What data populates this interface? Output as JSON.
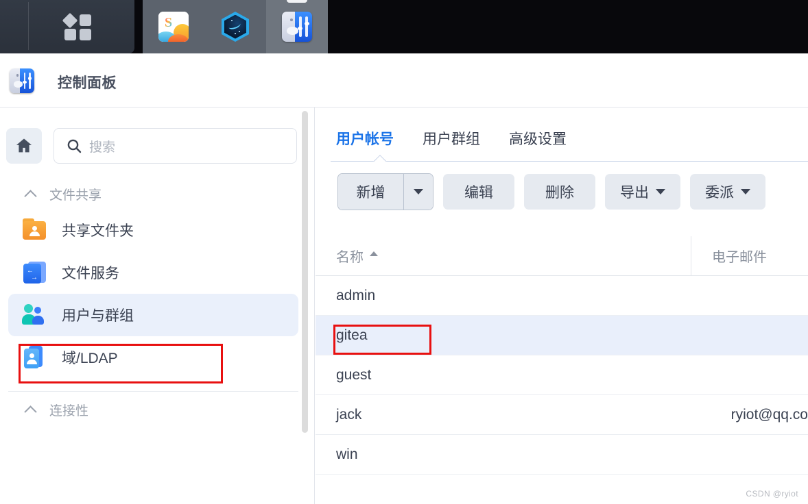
{
  "taskbar": {
    "menu_icon": "main-menu-icon",
    "apps": [
      {
        "name": "package-center",
        "icon": "package-center-icon",
        "active": false,
        "letter": "S"
      },
      {
        "name": "hexagon-app",
        "icon": "hexagon-app-icon",
        "active": false
      },
      {
        "name": "control-panel",
        "icon": "control-panel-icon",
        "active": true
      }
    ]
  },
  "window": {
    "title": "控制面板",
    "icon": "control-panel-icon"
  },
  "sidebar": {
    "home_icon": "home-icon",
    "search": {
      "placeholder": "搜索",
      "value": "",
      "icon": "search-icon"
    },
    "groups": [
      {
        "label": "文件共享",
        "collapse_icon": "chevron-up-icon",
        "items": [
          {
            "label": "共享文件夹",
            "icon": "shared-folder-icon",
            "selected": false
          },
          {
            "label": "文件服务",
            "icon": "file-service-icon",
            "selected": false
          },
          {
            "label": "用户与群组",
            "icon": "users-groups-icon",
            "selected": true
          },
          {
            "label": "域/LDAP",
            "icon": "domain-ldap-icon",
            "selected": false
          }
        ]
      },
      {
        "label": "连接性",
        "collapse_icon": "chevron-up-icon",
        "items": []
      }
    ]
  },
  "main": {
    "tabs": [
      {
        "label": "用户帐号",
        "active": true
      },
      {
        "label": "用户群组",
        "active": false
      },
      {
        "label": "高级设置",
        "active": false
      }
    ],
    "toolbar": [
      {
        "label": "新增",
        "type": "split",
        "has_caret": true
      },
      {
        "label": "编辑",
        "type": "button",
        "has_caret": false
      },
      {
        "label": "删除",
        "type": "button",
        "has_caret": false
      },
      {
        "label": "导出",
        "type": "dropdown",
        "has_caret": true
      },
      {
        "label": "委派",
        "type": "dropdown",
        "has_caret": true
      }
    ],
    "table": {
      "columns": [
        {
          "key": "name",
          "label": "名称",
          "sort": "asc"
        },
        {
          "key": "email",
          "label": "电子邮件",
          "sort": null
        }
      ],
      "rows": [
        {
          "name": "admin",
          "email": "",
          "selected": false
        },
        {
          "name": "gitea",
          "email": "",
          "selected": true
        },
        {
          "name": "guest",
          "email": "",
          "selected": false
        },
        {
          "name": "jack",
          "email": "ryiot@qq.co",
          "selected": false
        },
        {
          "name": "win",
          "email": "",
          "selected": false
        }
      ]
    }
  },
  "annotations": {
    "color": "#e81010",
    "boxes": [
      {
        "target": "sidebar-item-users-groups"
      },
      {
        "target": "table-cell-gitea"
      }
    ]
  },
  "watermark": "CSDN @ryiot",
  "colors": {
    "accent": "#1a73e8",
    "selected_row_bg": "#e9effb",
    "selected_nav_bg": "#eaf0fb",
    "annotation_red": "#e81010",
    "taskbar_bg": "#08080c"
  }
}
